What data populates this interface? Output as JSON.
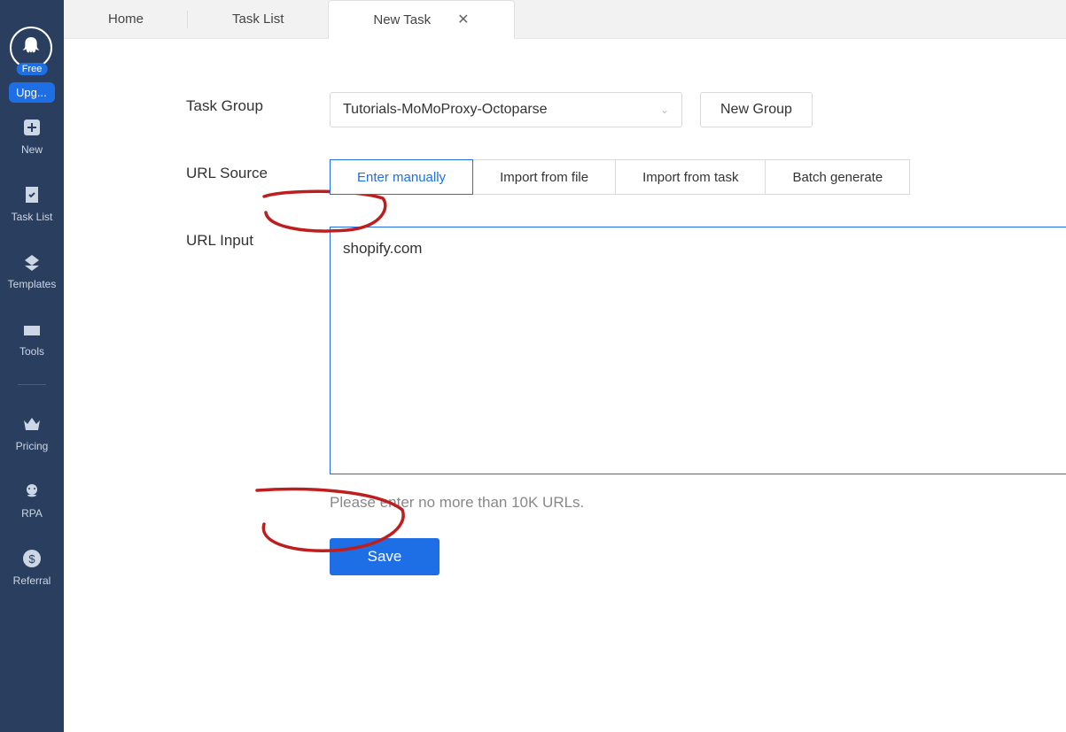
{
  "sidebar": {
    "plan_badge": "Free",
    "upgrade_label": "Upg...",
    "items": [
      {
        "id": "new",
        "label": "New",
        "icon": "plus-box-icon"
      },
      {
        "id": "tasklist",
        "label": "Task List",
        "icon": "checklist-icon"
      },
      {
        "id": "templates",
        "label": "Templates",
        "icon": "template-icon"
      },
      {
        "id": "tools",
        "label": "Tools",
        "icon": "toolbox-icon"
      },
      {
        "id": "pricing",
        "label": "Pricing",
        "icon": "crown-icon"
      },
      {
        "id": "rpa",
        "label": "RPA",
        "icon": "robot-icon"
      },
      {
        "id": "referral",
        "label": "Referral",
        "icon": "dollar-icon"
      }
    ]
  },
  "tabs": {
    "home": "Home",
    "tasklist": "Task List",
    "newtask": "New Task"
  },
  "form": {
    "task_group_label": "Task Group",
    "task_group_value": "Tutorials-MoMoProxy-Octoparse",
    "new_group_label": "New Group",
    "url_source_label": "URL Source",
    "source_options": {
      "manual": "Enter manually",
      "file": "Import from file",
      "task": "Import from task",
      "batch": "Batch generate"
    },
    "url_input_label": "URL Input",
    "url_input_value": "shopify.com",
    "url_hint": "Please enter no more than 10K URLs.",
    "save_label": "Save"
  }
}
